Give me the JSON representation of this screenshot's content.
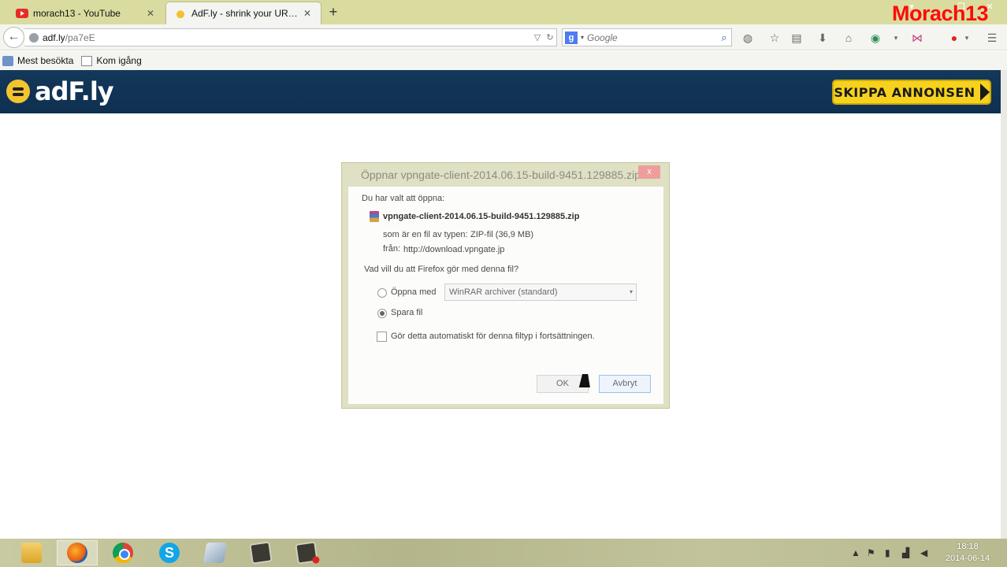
{
  "tabs": [
    {
      "title": "morach13 - YouTube",
      "favicon": "youtube-icon",
      "active": false
    },
    {
      "title": "AdF.ly - shrink your URLs a...",
      "favicon": "adfly-bee-icon",
      "active": true
    }
  ],
  "watermark": "Morach13",
  "nav": {
    "url_domain": "adf.ly",
    "url_path": "/pa7eE",
    "search_engine_letter": "g",
    "search_placeholder": "Google"
  },
  "bookmarks": [
    {
      "label": "Mest besökta",
      "icon": "bookmark-star-icon"
    },
    {
      "label": "Kom igång",
      "icon": "page-icon"
    }
  ],
  "adfly": {
    "logo_text": "adF.ly",
    "skip_label": "SKIPPA ANNONSEN",
    "colors": {
      "header": "#13385a",
      "skip": "#f6d21e"
    }
  },
  "dialog": {
    "title": "Öppnar vpngate-client-2014.06.15-build-9451.129885.zip",
    "close_label": "x",
    "intro": "Du har valt att öppna:",
    "filename": "vpngate-client-2014.06.15-build-9451.129885.zip",
    "type_label": "som är en fil av typen:",
    "type_value": "ZIP-fil (36,9 MB)",
    "from_label": "från:",
    "from_value": "http://download.vpngate.jp",
    "question": "Vad vill du att Firefox gör med denna fil?",
    "open_with_label": "Öppna med",
    "open_with_app": "WinRAR archiver (standard)",
    "save_label": "Spara fil",
    "selected_option": "save",
    "auto_label": "Gör detta automatiskt för denna filtyp i fortsättningen.",
    "auto_checked": false,
    "ok_label": "OK",
    "cancel_label": "Avbryt"
  },
  "taskbar": {
    "apps": [
      "file-explorer-icon",
      "firefox-icon",
      "chrome-icon",
      "skype-icon",
      "paper-icon",
      "slate-icon",
      "slate-recording-icon"
    ],
    "time": "18:18",
    "date": "2014-06-14"
  }
}
